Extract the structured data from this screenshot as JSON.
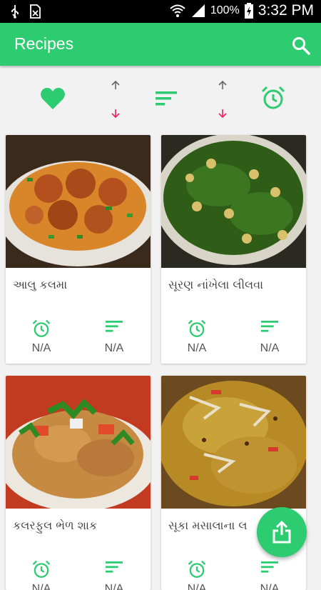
{
  "status_bar": {
    "battery_percent": "100%",
    "time": "3:32 PM"
  },
  "app_bar": {
    "title": "Recipes",
    "search_icon": "search-icon"
  },
  "sort_toolbar": {
    "favorite_icon": "heart-icon",
    "sort_icon": "sort-lines-icon",
    "time_icon": "alarm-clock-icon",
    "arrow_up_color": "#666666",
    "arrow_down_color": "#e91e63"
  },
  "recipes": [
    {
      "name": "આલુ કલમા",
      "time": "N/A",
      "servings": "N/A"
    },
    {
      "name": "સૂરણ નાંખેલા લીલવા",
      "time": "N/A",
      "servings": "N/A"
    },
    {
      "name": "કલરફુલ ભેળ શાક",
      "time": "N/A",
      "servings": "N/A"
    },
    {
      "name": "સૂકા મસાલાના લ",
      "time": "N/A",
      "servings": "N/A"
    }
  ],
  "fab": {
    "icon": "share-icon"
  },
  "colors": {
    "accent": "#2ecc71",
    "status_bar": "#000000"
  }
}
